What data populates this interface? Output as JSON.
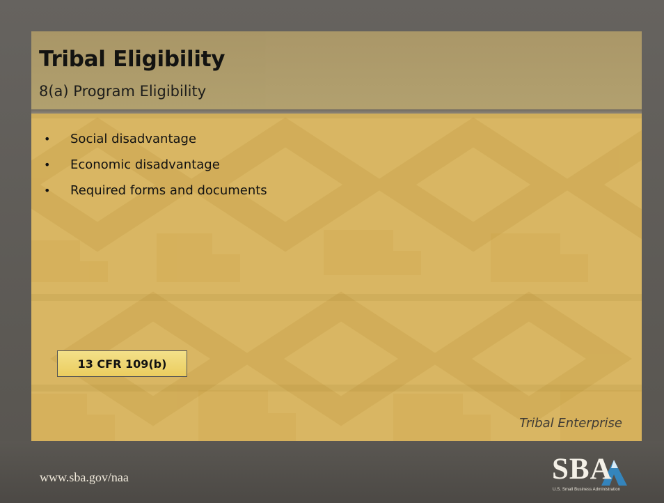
{
  "slide": {
    "title": "Tribal Eligibility",
    "subtitle": "8(a) Program Eligibility",
    "bullets": [
      "Social disadvantage",
      "Economic disadvantage",
      "Required forms and documents"
    ],
    "callout": "13 CFR 109(b)",
    "footer_tag": "Tribal Enterprise"
  },
  "footer": {
    "url": "www.sba.gov/naa",
    "logo": {
      "wordmark": "SBA",
      "tagline": "U.S. Small Business Administration"
    }
  },
  "colors": {
    "frame": "#5c5a56",
    "slide_background": "#d9b663",
    "title_bar": "#a99668",
    "callout_fill": "#efd56f",
    "footer_text": "#efe8da",
    "logo_accent": "#2f8ed0"
  },
  "icons": {
    "bullet": "bullet-dot-icon",
    "logo": "sba-logo-icon"
  }
}
